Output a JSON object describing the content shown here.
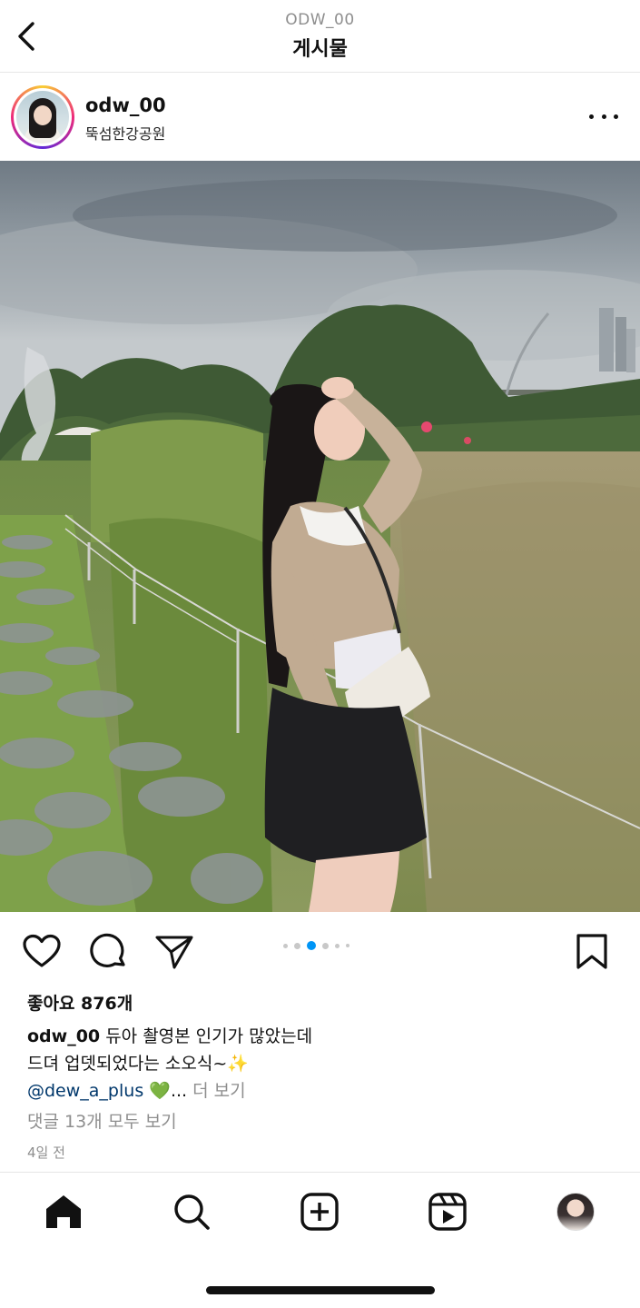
{
  "header": {
    "subtitle": "ODW_00",
    "title": "게시물"
  },
  "post": {
    "username": "odw_00",
    "location": "뚝섬한강공원",
    "photo_description_icon": "photo",
    "carousel": {
      "count": 6,
      "active_index": 2
    },
    "likes_text": "좋아요 876개",
    "caption_user": "odw_00",
    "caption_line1": " 듀아 촬영본 인기가 많았는데",
    "caption_line2": "드뎌 업뎃되었다는 소오식~",
    "caption_sparkle": "✨",
    "caption_mention": "@dew_a_plus",
    "caption_heart": "💚",
    "caption_ellipsis": "...",
    "more_label": "더 보기",
    "comments_text": "댓글 13개 모두 보기",
    "time_text": "4일 전"
  },
  "actions": [
    "heart-icon",
    "comment-icon",
    "share-icon",
    "bookmark-icon"
  ],
  "nav": [
    "home-icon",
    "search-icon",
    "create-icon",
    "reels-icon",
    "profile-avatar"
  ],
  "colors": {
    "accent": "#0095f6",
    "mention": "#00376b",
    "muted": "#8e8e8e"
  }
}
